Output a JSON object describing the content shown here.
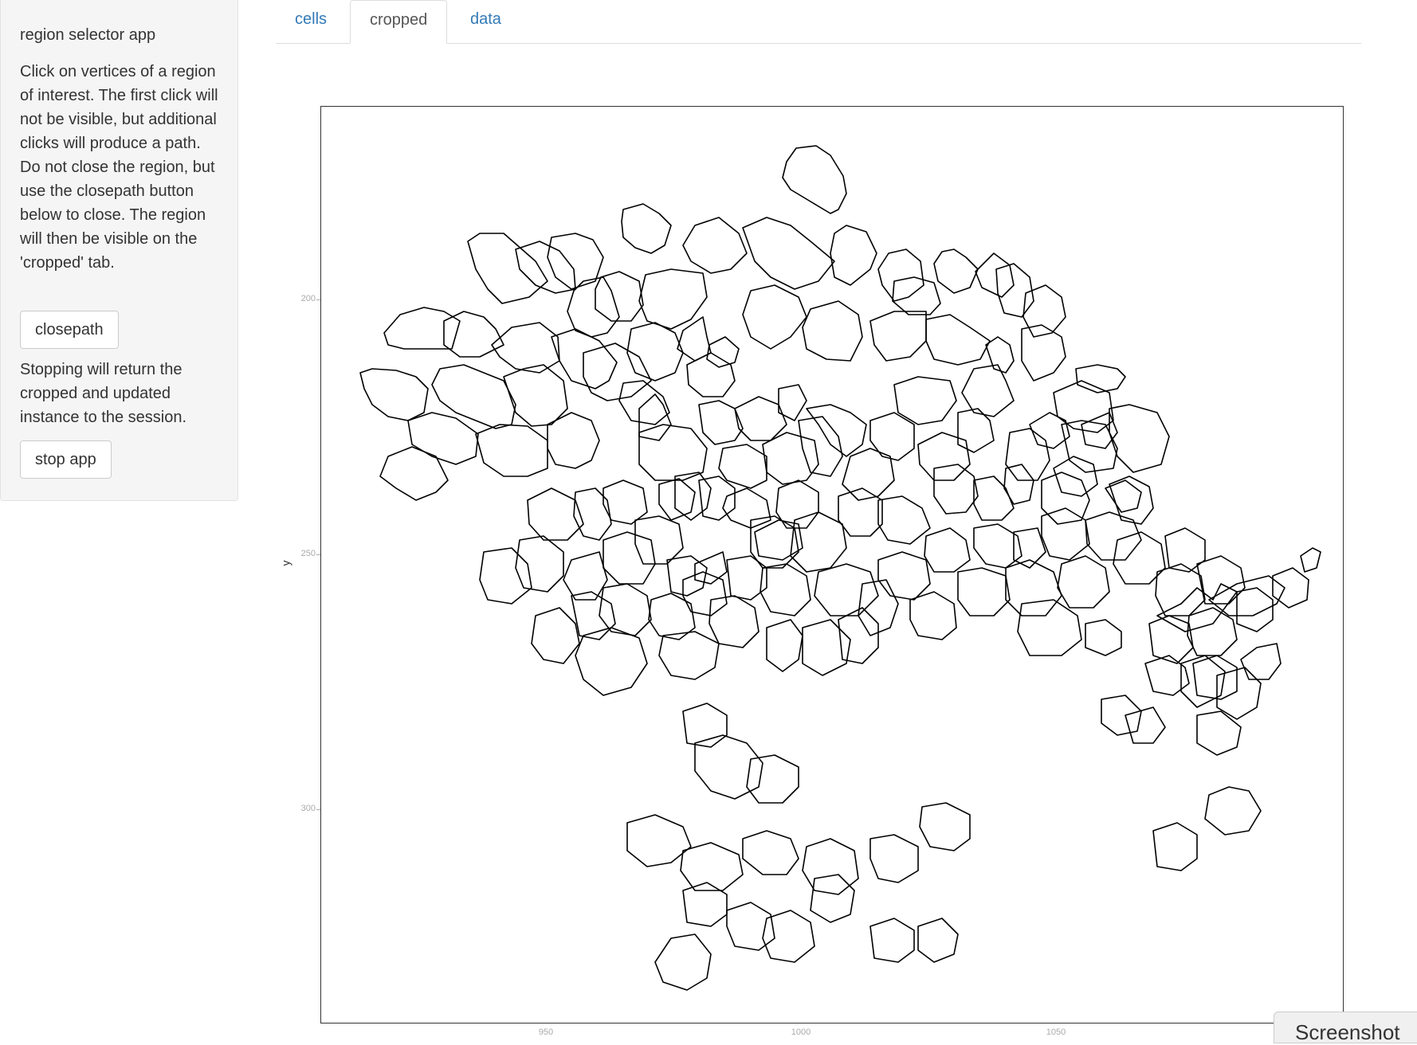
{
  "sidebar": {
    "title": "region selector app",
    "instructions": "Click on vertices of a region of interest. The first click will not be visible, but additional clicks will produce a path. Do not close the region, but use the closepath button below to close. The region will then be visible on the 'cropped' tab.",
    "closepath_label": "closepath",
    "stop_note": "Stopping will return the cropped and updated instance to the session.",
    "stop_label": "stop app"
  },
  "tabs": [
    {
      "label": "cells",
      "active": false
    },
    {
      "label": "cropped",
      "active": true
    },
    {
      "label": "data",
      "active": false
    }
  ],
  "plot": {
    "ylabel": "y",
    "yticks": [
      "200",
      "250",
      "300"
    ],
    "xticks": [
      "950",
      "1000",
      "1050"
    ]
  },
  "screenshot_label": "Screenshot"
}
